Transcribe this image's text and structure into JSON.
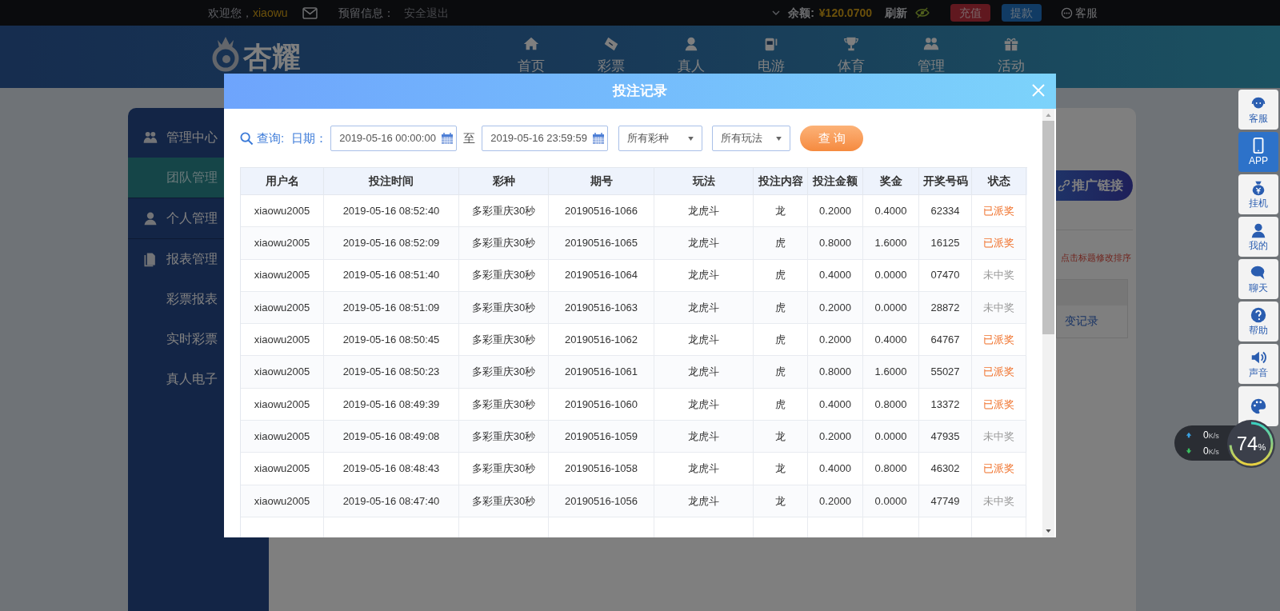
{
  "top_bar": {
    "greeting": "欢迎您，",
    "username": "xiaowu",
    "reserved_label": "预留信息：",
    "logout": "安全退出",
    "balance_label": "余额:",
    "balance": "¥120.0700",
    "refresh": "刷新",
    "deposit": "充值",
    "withdraw": "提款",
    "service": "客服"
  },
  "logo": {
    "text": "杏耀"
  },
  "nav": [
    {
      "label": "首页"
    },
    {
      "label": "彩票"
    },
    {
      "label": "真人"
    },
    {
      "label": "电游"
    },
    {
      "label": "体育"
    },
    {
      "label": "管理"
    },
    {
      "label": "活动"
    }
  ],
  "sidebar": [
    {
      "label": "管理中心",
      "selected": false,
      "children": [
        {
          "label": "团队管理",
          "selected": true
        }
      ]
    },
    {
      "label": "个人管理",
      "selected": false
    },
    {
      "label": "报表管理",
      "selected": false,
      "children": [
        {
          "label": "彩票报表",
          "selected": false
        },
        {
          "label": "实时彩票",
          "selected": false
        },
        {
          "label": "真人电子",
          "selected": false
        }
      ]
    }
  ],
  "background_panel": {
    "promo_button": "推广链接",
    "hint": "点击标题修改排序",
    "cell": "变记录"
  },
  "dock": [
    {
      "label": "客服",
      "selected": false
    },
    {
      "label": "APP",
      "selected": true
    },
    {
      "label": "挂机",
      "selected": false
    },
    {
      "label": "我的",
      "selected": false
    },
    {
      "label": "聊天",
      "selected": false
    },
    {
      "label": "帮助",
      "selected": false
    },
    {
      "label": "声音",
      "selected": false
    },
    {
      "selected": false
    }
  ],
  "speed_widget": {
    "upload": "0",
    "upload_unit": "K/s",
    "download": "0",
    "download_unit": "K/s",
    "percent": "74",
    "percent_sign": "%"
  },
  "modal": {
    "title": "投注记录",
    "query_label": "查询:",
    "date_label": "日期：",
    "date_from": "2019-05-16 00:00:00",
    "to_label": "至",
    "date_to": "2019-05-16 23:59:59",
    "lottery_select": "所有彩种",
    "play_select": "所有玩法",
    "query_button": "查 询",
    "table": {
      "columns": [
        "用户名",
        "投注时间",
        "彩种",
        "期号",
        "玩法",
        "投注内容",
        "投注金额",
        "奖金",
        "开奖号码",
        "状态"
      ],
      "rows": [
        {
          "cells": [
            "xiaowu2005",
            "2019-05-16 08:52:40",
            "多彩重庆30秒",
            "20190516-1066",
            "龙虎斗",
            "龙",
            "0.2000",
            "0.4000",
            "62334",
            "已派奖"
          ],
          "won": true
        },
        {
          "cells": [
            "xiaowu2005",
            "2019-05-16 08:52:09",
            "多彩重庆30秒",
            "20190516-1065",
            "龙虎斗",
            "虎",
            "0.8000",
            "1.6000",
            "16125",
            "已派奖"
          ],
          "won": true
        },
        {
          "cells": [
            "xiaowu2005",
            "2019-05-16 08:51:40",
            "多彩重庆30秒",
            "20190516-1064",
            "龙虎斗",
            "虎",
            "0.4000",
            "0.0000",
            "07470",
            "未中奖"
          ],
          "won": false
        },
        {
          "cells": [
            "xiaowu2005",
            "2019-05-16 08:51:09",
            "多彩重庆30秒",
            "20190516-1063",
            "龙虎斗",
            "虎",
            "0.2000",
            "0.0000",
            "28872",
            "未中奖"
          ],
          "won": false
        },
        {
          "cells": [
            "xiaowu2005",
            "2019-05-16 08:50:45",
            "多彩重庆30秒",
            "20190516-1062",
            "龙虎斗",
            "虎",
            "0.2000",
            "0.4000",
            "64767",
            "已派奖"
          ],
          "won": true
        },
        {
          "cells": [
            "xiaowu2005",
            "2019-05-16 08:50:23",
            "多彩重庆30秒",
            "20190516-1061",
            "龙虎斗",
            "虎",
            "0.8000",
            "1.6000",
            "55027",
            "已派奖"
          ],
          "won": true
        },
        {
          "cells": [
            "xiaowu2005",
            "2019-05-16 08:49:39",
            "多彩重庆30秒",
            "20190516-1060",
            "龙虎斗",
            "虎",
            "0.4000",
            "0.8000",
            "13372",
            "已派奖"
          ],
          "won": true
        },
        {
          "cells": [
            "xiaowu2005",
            "2019-05-16 08:49:08",
            "多彩重庆30秒",
            "20190516-1059",
            "龙虎斗",
            "龙",
            "0.2000",
            "0.0000",
            "47935",
            "未中奖"
          ],
          "won": false
        },
        {
          "cells": [
            "xiaowu2005",
            "2019-05-16 08:48:43",
            "多彩重庆30秒",
            "20190516-1058",
            "龙虎斗",
            "龙",
            "0.4000",
            "0.8000",
            "46302",
            "已派奖"
          ],
          "won": true
        },
        {
          "cells": [
            "xiaowu2005",
            "2019-05-16 08:47:40",
            "多彩重庆30秒",
            "20190516-1056",
            "龙虎斗",
            "龙",
            "0.2000",
            "0.0000",
            "47749",
            "未中奖"
          ],
          "won": false
        }
      ]
    }
  }
}
